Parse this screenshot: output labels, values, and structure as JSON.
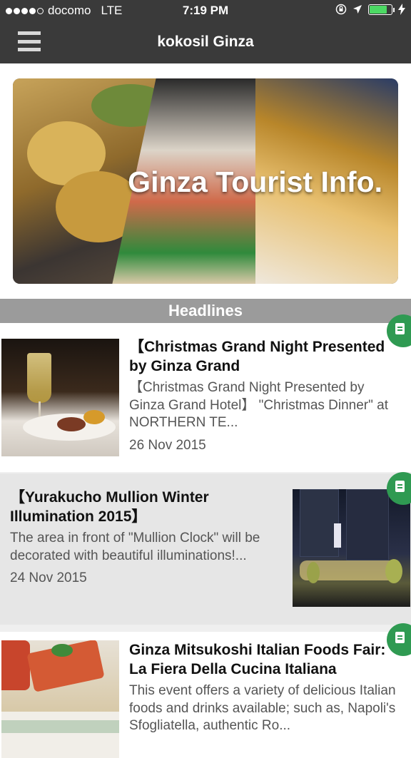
{
  "status_bar": {
    "carrier": "docomo",
    "network": "LTE",
    "time": "7:19 PM",
    "signal_bars_filled": 4,
    "signal_bars_total": 5,
    "battery_level": 0.8
  },
  "nav": {
    "title": "kokosil Ginza",
    "menu_icon": "hamburger-menu-icon"
  },
  "hero": {
    "title": "Ginza Tourist Info."
  },
  "section": {
    "title": "Headlines"
  },
  "articles": [
    {
      "title": "【Christmas Grand Night Presented by Ginza Grand",
      "body": "【Christmas Grand Night Presented by Ginza Grand Hotel】 \"Christmas Dinner\" at NORTHERN TE...",
      "date": "26 Nov 2015",
      "badge_icon": "document-icon"
    },
    {
      "title": "【Yurakucho Mullion Winter Illumination 2015】",
      "body": "The area in front of \"Mullion Clock\" will be decorated with beautiful illuminations!...",
      "date": "24 Nov 2015",
      "badge_icon": "document-icon"
    },
    {
      "title": "Ginza Mitsukoshi Italian Foods Fair: La Fiera Della Cucina Italiana",
      "body": "This event offers a variety of delicious Italian foods and drinks available; such as, Napoli's Sfogliatella, authentic Ro...",
      "date": "",
      "badge_icon": "document-icon"
    }
  ]
}
